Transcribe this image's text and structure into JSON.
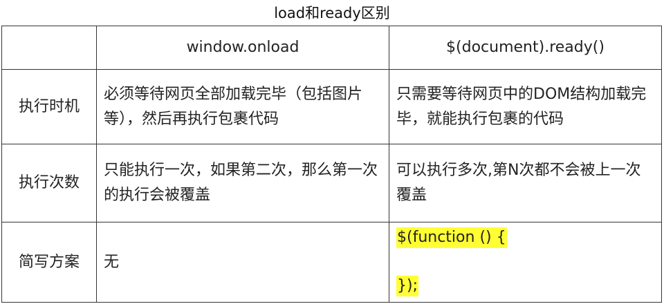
{
  "title": "load和ready区别",
  "table": {
    "headers": [
      "",
      "window.onload",
      "$(document).ready()"
    ],
    "rows": [
      {
        "label": "执行时机",
        "onload": "必须等待网页全部加载完毕（包括图片等），然后再执行包裹代码",
        "ready": "只需要等待网页中的DOM结构加载完毕，就能执行包裹的代码"
      },
      {
        "label": "执行次数",
        "onload": "只能执行一次，如果第二次，那么第一次的执行会被覆盖",
        "ready": "可以执行多次,第N次都不会被上一次覆盖"
      },
      {
        "label": "简写方案",
        "onload": "无",
        "ready_code": [
          "$(function () {",
          "});"
        ]
      }
    ]
  },
  "colors": {
    "highlight": "#ffff33",
    "border": "#333333"
  }
}
